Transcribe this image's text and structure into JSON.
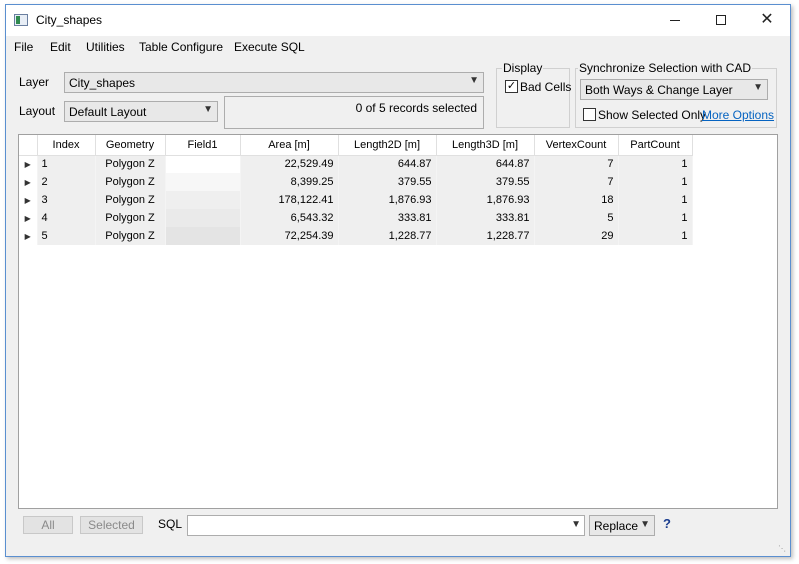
{
  "window": {
    "title": "City_shapes",
    "icon": "table-window-icon"
  },
  "menu": [
    "File",
    "Edit",
    "Utilities",
    "Table Configure",
    "Execute SQL"
  ],
  "layer": {
    "label": "Layer",
    "value": "City_shapes"
  },
  "layout": {
    "label": "Layout",
    "value": "Default Layout"
  },
  "status": "0 of 5 records selected",
  "display": {
    "title": "Display",
    "bad_cells_label": "Bad Cells",
    "bad_cells_checked": true
  },
  "sync": {
    "title": "Synchronize Selection with CAD",
    "mode": "Both Ways & Change Layer",
    "show_selected_label": "Show Selected Only",
    "show_selected_checked": false,
    "more_options": "More Options"
  },
  "table": {
    "columns": [
      "Index",
      "Geometry",
      "Field1",
      "Area [m]",
      "Length2D [m]",
      "Length3D [m]",
      "VertexCount",
      "PartCount"
    ],
    "rows": [
      [
        "1",
        "Polygon Z",
        "",
        "22,529.49",
        "644.87",
        "644.87",
        "7",
        "1"
      ],
      [
        "2",
        "Polygon Z",
        "",
        "8,399.25",
        "379.55",
        "379.55",
        "7",
        "1"
      ],
      [
        "3",
        "Polygon Z",
        "",
        "178,122.41",
        "1,876.93",
        "1,876.93",
        "18",
        "1"
      ],
      [
        "4",
        "Polygon Z",
        "",
        "6,543.32",
        "333.81",
        "333.81",
        "5",
        "1"
      ],
      [
        "5",
        "Polygon Z",
        "",
        "72,254.39",
        "1,228.77",
        "1,228.77",
        "29",
        "1"
      ]
    ]
  },
  "bottom": {
    "all_button": "All",
    "selected_button": "Selected",
    "sql_label": "SQL",
    "sql_value": "",
    "replace_value": "Replace",
    "help": "?"
  }
}
